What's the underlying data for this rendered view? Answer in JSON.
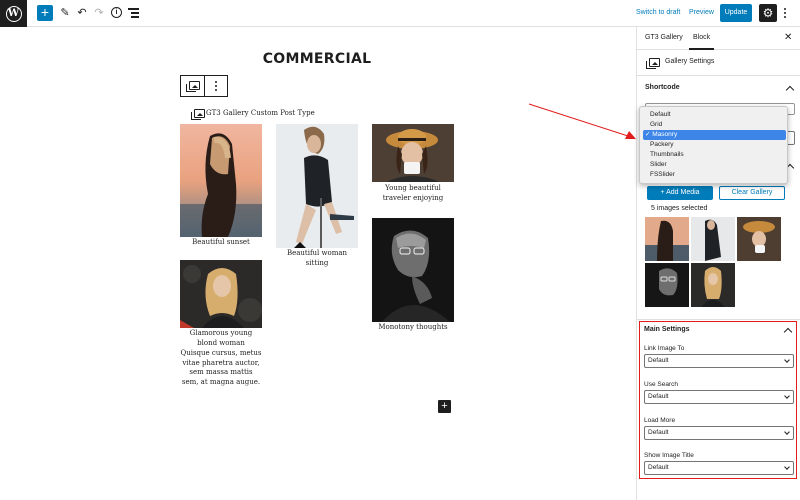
{
  "topbar": {
    "switch_draft": "Switch to draft",
    "preview": "Preview",
    "update": "Update"
  },
  "editor": {
    "page_title": "COMMERCIAL",
    "block_label": "GT3 Gallery Custom Post Type",
    "items": [
      {
        "caption": "Beautiful sunset"
      },
      {
        "caption": "Beautiful woman sitting"
      },
      {
        "caption": "Young beautiful traveler enjoying"
      },
      {
        "caption": "Glamorous young blond woman",
        "description": "Quisque cursus, metus vitae pharetra auctor, sem massa mattis sem, at magna augue."
      },
      {
        "caption": "Monotony thoughts"
      }
    ]
  },
  "sidebar": {
    "tabs": [
      "GT3 Gallery",
      "Block"
    ],
    "gallery_settings": "Gallery Settings",
    "shortcode": "Shortcode",
    "add_media": "+ Add Media",
    "clear_gallery": "Clear Gallery",
    "images_selected": "5 images selected",
    "main_settings": {
      "title": "Main Settings",
      "fields": [
        {
          "label": "Link Image To",
          "value": "Default"
        },
        {
          "label": "Use Search",
          "value": "Default"
        },
        {
          "label": "Load More",
          "value": "Default"
        },
        {
          "label": "Show Image Title",
          "value": "Default"
        }
      ]
    }
  },
  "type_dropdown": {
    "options": [
      "Default",
      "Grid",
      "Masonry",
      "Packery",
      "Thumbnails",
      "Slider",
      "FSSlider"
    ],
    "selected": "Masonry",
    "check": "✓"
  },
  "colors": {
    "accent": "#007cba",
    "highlight": "#e21b1b",
    "selected_option": "#3d86e8"
  }
}
